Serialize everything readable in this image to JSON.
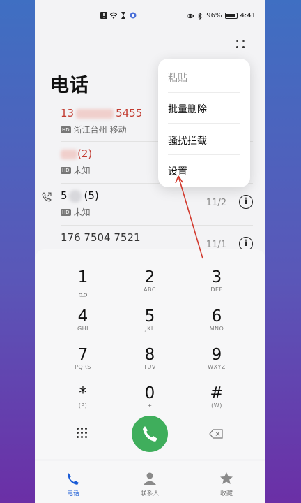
{
  "status_bar": {
    "battery": "96%",
    "time": "4:41"
  },
  "title": "电话",
  "calls": [
    {
      "name_start": "13",
      "name_end": "5455",
      "location": "浙江台州 移动",
      "missed": true
    },
    {
      "name": "(2)",
      "location": "未知",
      "missed": true
    },
    {
      "name_start": "5",
      "name_end": "(5)",
      "location": "未知",
      "date": "11/2",
      "missed": false
    },
    {
      "name": "176 7504 7521",
      "date": "11/1",
      "missed": false
    }
  ],
  "menu": {
    "items": [
      "粘贴",
      "批量删除",
      "骚扰拦截",
      "设置"
    ]
  },
  "dialpad": {
    "keys": [
      {
        "digit": "1",
        "letters": ""
      },
      {
        "digit": "2",
        "letters": "ABC"
      },
      {
        "digit": "3",
        "letters": "DEF"
      },
      {
        "digit": "4",
        "letters": "GHI"
      },
      {
        "digit": "5",
        "letters": "JKL"
      },
      {
        "digit": "6",
        "letters": "MNO"
      },
      {
        "digit": "7",
        "letters": "PQRS"
      },
      {
        "digit": "8",
        "letters": "TUV"
      },
      {
        "digit": "9",
        "letters": "WXYZ"
      },
      {
        "digit": "*",
        "letters": "(P)"
      },
      {
        "digit": "0",
        "letters": "+"
      },
      {
        "digit": "#",
        "letters": "(W)"
      }
    ]
  },
  "nav": {
    "phone": "电话",
    "contacts": "联系人",
    "favorites": "收藏"
  },
  "colors": {
    "accent": "#1a5bd6",
    "call_green": "#3fae5c",
    "missed_red": "#c23b30"
  }
}
